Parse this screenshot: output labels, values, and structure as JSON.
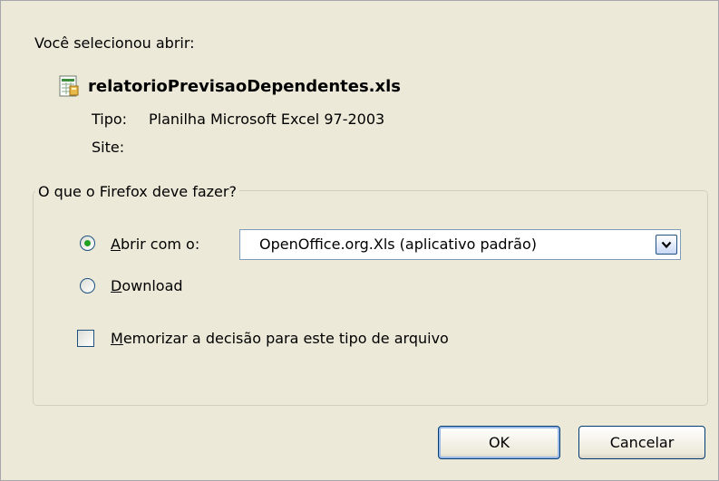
{
  "dialog": {
    "intro": "Você selecionou abrir:",
    "file": {
      "name": "relatorioPrevisaoDependentes.xls",
      "icon": "spreadsheet-icon",
      "type_label": "Tipo:",
      "type_value": "Planilha Microsoft Excel 97-2003",
      "site_label": "Site:",
      "site_value": ""
    },
    "group": {
      "title": "O que o Firefox deve fazer?",
      "open_with": {
        "access_key": "A",
        "label_rest": "brir com o:",
        "selected": true
      },
      "app_select": {
        "value": "OpenOffice.org.Xls (aplicativo padrão)"
      },
      "download": {
        "access_key": "D",
        "label_rest": "ownload",
        "selected": false
      },
      "remember": {
        "access_key": "M",
        "label_rest": "emorizar a decisão para este tipo de arquivo",
        "checked": false
      }
    },
    "buttons": {
      "ok": "OK",
      "cancel": "Cancelar"
    },
    "colors": {
      "background": "#ece9d8",
      "radio_dot": "#21a121",
      "border_blue": "#1c5180"
    }
  }
}
